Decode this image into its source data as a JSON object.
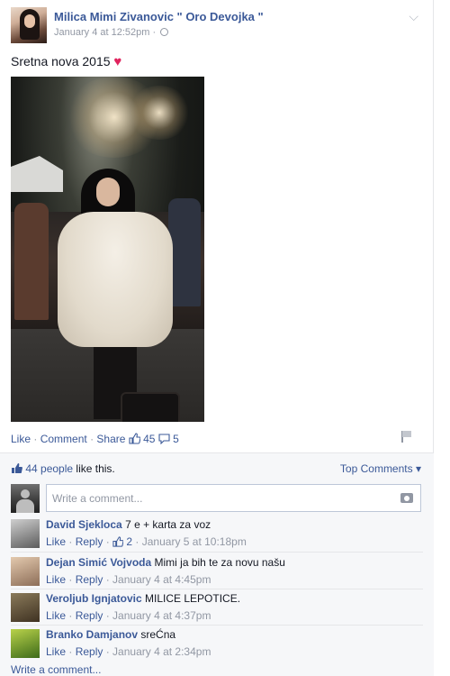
{
  "post": {
    "author": "Milica Mimi Zivanovic \" Oro Devojka \"",
    "timestamp": "January 4 at 12:52pm",
    "audience_icon": "globe-icon",
    "message": "Sretna nova 2015",
    "message_emoji": "♥"
  },
  "actions": {
    "like": "Like",
    "comment": "Comment",
    "share": "Share",
    "like_count": "45",
    "comment_count": "5"
  },
  "footer": {
    "likes_count_text": "44 people",
    "likes_suffix": "like this.",
    "top_comments": "Top Comments",
    "top_comments_arrow": "▾",
    "comment_placeholder": "Write a comment...",
    "write_comment_link": "Write a comment..."
  },
  "comments": [
    {
      "name": "David Sjekloca",
      "text": "7 e + karta za voz",
      "like": "Like",
      "reply": "Reply",
      "likes": "2",
      "time": "January 5 at 10:18pm"
    },
    {
      "name": "Dejan Simić Vojvoda",
      "text": "Mimi ja bih te za novu našu",
      "like": "Like",
      "reply": "Reply",
      "likes": "",
      "time": "January 4 at 4:45pm"
    },
    {
      "name": "Veroljub Ignjatovic",
      "text": "MILICE LEPOTICE.",
      "like": "Like",
      "reply": "Reply",
      "likes": "",
      "time": "January 4 at 4:37pm"
    },
    {
      "name": "Branko Damjanov",
      "text": "sreĆna",
      "like": "Like",
      "reply": "Reply",
      "likes": "",
      "time": "January 4 at 2:34pm"
    }
  ],
  "colors": {
    "link": "#3b5998",
    "meta": "#9197a3",
    "heart": "#e0245e",
    "footer_bg": "#f6f7f9"
  }
}
